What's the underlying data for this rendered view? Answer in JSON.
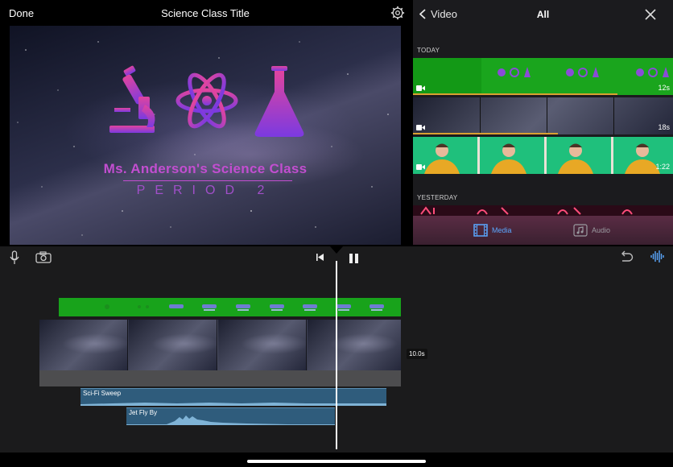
{
  "viewer": {
    "done_label": "Done",
    "title": "Science Class Title",
    "overlay_line1": "Ms. Anderson's Science Class",
    "overlay_line2": "PERIOD 2"
  },
  "browser": {
    "back_label": "Video",
    "filter_label": "All",
    "sections": [
      {
        "label": "TODAY",
        "clips": [
          {
            "duration": "12s"
          },
          {
            "duration": "18s"
          },
          {
            "duration": "1:22"
          }
        ]
      },
      {
        "label": "YESTERDAY",
        "clips": []
      }
    ],
    "tabs": {
      "media": "Media",
      "audio": "Audio"
    }
  },
  "timeline": {
    "duration_badge": "10.0s",
    "audio_clips": [
      {
        "name": "Sci-Fi Sweep"
      },
      {
        "name": "Jet Fly By"
      }
    ]
  },
  "colors": {
    "accent_blue": "#5aa7ff",
    "green_screen": "#18a31b",
    "title_magenta": "#c24ed0",
    "audio_clip": "#2f5c7c"
  }
}
